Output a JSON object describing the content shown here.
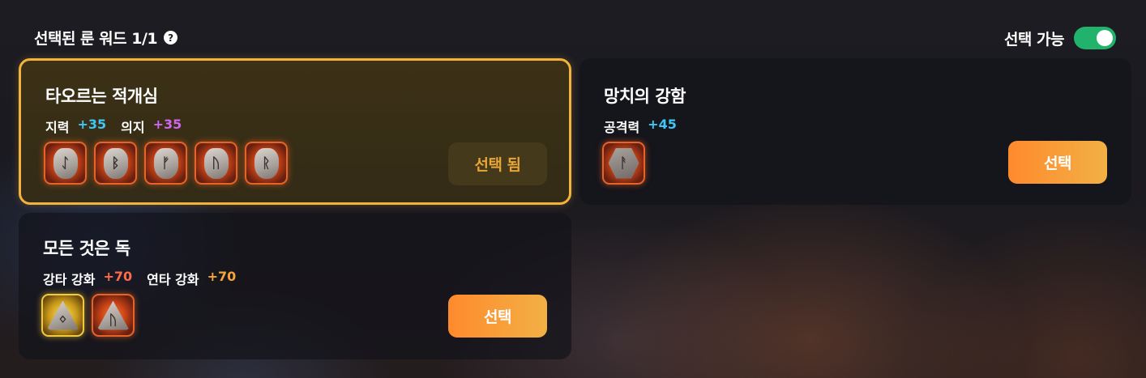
{
  "header": {
    "title": "선택된 룬 워드 1/1",
    "help_glyph": "?",
    "toggle_label": "선택 가능",
    "toggle_on": true
  },
  "cards": [
    {
      "title": "타오르는 적개심",
      "stats": [
        {
          "name": "지력",
          "value": "+35",
          "color": "#3ec6f4"
        },
        {
          "name": "의지",
          "value": "+35",
          "color": "#d065ee"
        }
      ],
      "runes": [
        "ᛇ",
        "ᛒ",
        "ᚠ",
        "ᚢ",
        "ᚱ"
      ],
      "button_label": "선택 됨",
      "selected": true
    },
    {
      "title": "망치의 강함",
      "stats": [
        {
          "name": "공격력",
          "value": "+45",
          "color": "#3ec6f4"
        }
      ],
      "runes": [
        "ᚨ"
      ],
      "button_label": "선택",
      "selected": false
    },
    {
      "title": "모든 것은 독",
      "stats": [
        {
          "name": "강타 강화",
          "value": "+70",
          "color": "#ff6a4a"
        },
        {
          "name": "연타 강화",
          "value": "+70",
          "color": "#f4a63a"
        }
      ],
      "runes": [
        "ᛜ",
        "ᚢ"
      ],
      "button_label": "선택",
      "selected": false
    }
  ],
  "colors": {
    "accent_gold": "#f2b23c",
    "button_orange": "#ff8a2e",
    "toggle_green": "#21b36b"
  }
}
